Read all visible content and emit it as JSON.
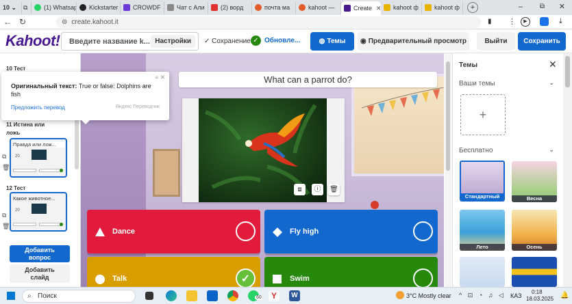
{
  "browser": {
    "tab_count": "10",
    "tabs": [
      {
        "label": "(1) Whatsapp",
        "color": "#25d366"
      },
      {
        "label": "Kickstarter",
        "color": "#222222"
      },
      {
        "label": "CROWDF",
        "color": "#6c3ad6"
      },
      {
        "label": "Чат с Али",
        "color": "#888888"
      },
      {
        "label": "(2) ворд",
        "color": "#e03030"
      },
      {
        "label": "почта ма",
        "color": "#e05c2b"
      },
      {
        "label": "kahoot —",
        "color": "#e05c2b"
      },
      {
        "label": "Create",
        "color": "#46178f"
      },
      {
        "label": "kahoot ф",
        "color": "#e8b400"
      },
      {
        "label": "kahoot ф",
        "color": "#e8b400"
      }
    ],
    "url": "create.kahoot.it",
    "page_title": "Create kahoot - Kahoot!"
  },
  "header": {
    "logo": "Kahoot!",
    "title_placeholder": "Введите название k...",
    "settings": "Настройки",
    "save_status": "Сохранение",
    "update_label": "Обновле...",
    "themes": "Темы",
    "preview": "Предварительный просмотр",
    "exit": "Выйти",
    "save": "Сохранить"
  },
  "sidebar": {
    "slides": [
      {
        "label": "10  Тест"
      },
      {
        "label": "11  Истина или ложь",
        "thumb_title": "Правда или лож...",
        "time": "20"
      },
      {
        "label": "12  Тест",
        "thumb_title": "Какое животное...",
        "time": "20"
      }
    ],
    "add_question": "Добавить вопрос",
    "add_slide": "Добавить слайд"
  },
  "popup": {
    "original_label": "Оригинальный текст:",
    "original_text": "True or false: Dolphins are fish",
    "suggest": "Предложить перевод",
    "credit": "Яндекс Переводчик"
  },
  "question": {
    "text": "What can a parrot do?",
    "answers": [
      {
        "text": "Dance",
        "color": "#e21b3c",
        "shape": "triangle",
        "correct": false
      },
      {
        "text": "Fly high",
        "color": "#1368ce",
        "shape": "diamond",
        "correct": false
      },
      {
        "text": "Talk",
        "color": "#d89e00",
        "shape": "circle",
        "correct": true
      },
      {
        "text": "Swim",
        "color": "#26890c",
        "shape": "square",
        "correct": false
      }
    ]
  },
  "themes_panel": {
    "title": "Темы",
    "your_themes": "Ваши темы",
    "free": "Бесплатно",
    "cards": [
      {
        "label": "Стандартный",
        "selected": true
      },
      {
        "label": "Весна"
      },
      {
        "label": "Лето"
      },
      {
        "label": "Осень"
      }
    ]
  },
  "taskbar": {
    "search": "Поиск",
    "weather": "3°C  Mostly clear",
    "lang": "КАЗ",
    "time": "0:18",
    "date": "18.03.2025",
    "badge": "60"
  }
}
